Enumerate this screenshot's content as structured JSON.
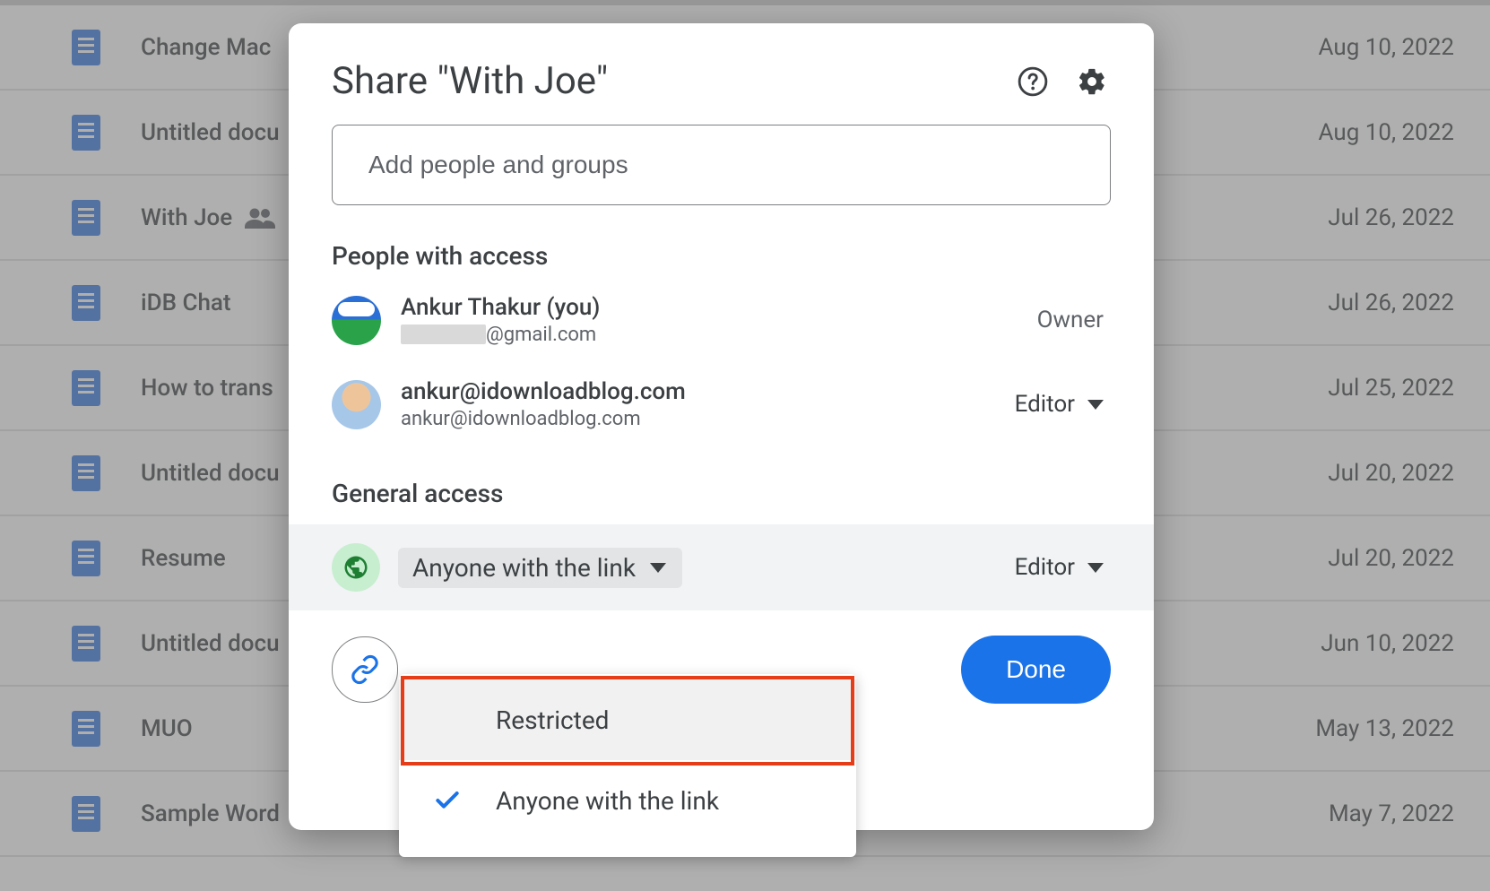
{
  "files": [
    {
      "name": "Change Mac",
      "date": "Aug 10, 2022",
      "shared": false
    },
    {
      "name": "Untitled docu",
      "date": "Aug 10, 2022",
      "shared": false
    },
    {
      "name": "With Joe",
      "date": "Jul 26, 2022",
      "shared": true,
      "selected": true
    },
    {
      "name": "iDB Chat",
      "date": "Jul 26, 2022",
      "shared": false
    },
    {
      "name": "How to trans",
      "date": "Jul 25, 2022",
      "shared": false
    },
    {
      "name": "Untitled docu",
      "date": "Jul 20, 2022",
      "shared": false
    },
    {
      "name": "Resume",
      "date": "Jul 20, 2022",
      "shared": false
    },
    {
      "name": "Untitled docu",
      "date": "Jun 10, 2022",
      "shared": false
    },
    {
      "name": "MUO",
      "date": "May 13, 2022",
      "shared": false
    },
    {
      "name": "Sample Word",
      "date": "May 7, 2022",
      "shared": false
    }
  ],
  "dialog": {
    "title": "Share \"With Joe\"",
    "add_placeholder": "Add people and groups",
    "people_heading": "People with access",
    "owner_label": "Owner",
    "people": [
      {
        "name": "Ankur Thakur (you)",
        "email_suffix": "@gmail.com",
        "role": "Owner"
      },
      {
        "name": "ankur@idownloadblog.com",
        "email": "ankur@idownloadblog.com",
        "role": "Editor"
      }
    ],
    "general_heading": "General access",
    "general_selected": "Anyone with the link",
    "general_role": "Editor",
    "done": "Done",
    "menu": {
      "restricted": "Restricted",
      "anyone": "Anyone with the link"
    }
  }
}
